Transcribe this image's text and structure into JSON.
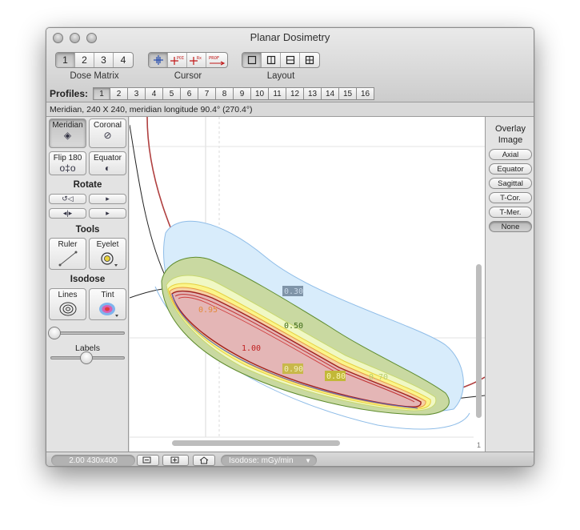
{
  "window": {
    "title": "Planar Dosimetry"
  },
  "toolbar": {
    "dose_matrix": {
      "label": "Dose Matrix",
      "options": [
        "1",
        "2",
        "3",
        "4"
      ],
      "selected": "1"
    },
    "cursor": {
      "label": "Cursor",
      "tools": [
        {
          "name": "crosshair",
          "text": ""
        },
        {
          "name": "poi",
          "text": "POI"
        },
        {
          "name": "rx",
          "text": "Rx"
        },
        {
          "name": "prof",
          "text": "PROF"
        }
      ]
    },
    "layout": {
      "label": "Layout"
    }
  },
  "profiles": {
    "label": "Profiles:",
    "items": [
      "1",
      "2",
      "3",
      "4",
      "5",
      "6",
      "7",
      "8",
      "9",
      "10",
      "11",
      "12",
      "13",
      "14",
      "15",
      "16"
    ],
    "selected": "1"
  },
  "info_line": "Meridian, 240 X 240, meridian longitude 90.4° (270.4°)",
  "left_panel": {
    "view_buttons": {
      "meridian": "Meridian",
      "coronal": "Coronal",
      "flip": "Flip 180",
      "equator": "Equator"
    },
    "rotate": {
      "label": "Rotate"
    },
    "tools": {
      "label": "Tools",
      "ruler": "Ruler",
      "eyelet": "Eyelet"
    },
    "isodose": {
      "label": "Isodose",
      "lines": "Lines",
      "tint": "Tint"
    },
    "labels_slider": {
      "label": "Labels"
    }
  },
  "overlay": {
    "title_line1": "Overlay",
    "title_line2": "Image",
    "options": [
      "Axial",
      "Equator",
      "Sagittal",
      "T-Cor.",
      "T-Mer.",
      "None"
    ],
    "selected": "None"
  },
  "canvas": {
    "isodose_labels": {
      "l100": "1.00",
      "l095": "0.95",
      "l090": "0.90",
      "l080": "0.80",
      "l070": "0.70",
      "l050": "0.50",
      "l030": "0.30"
    },
    "scroll_page": "1"
  },
  "status_bar": {
    "zoom_info": "2.00 430x400",
    "isodose_unit": "Isodose: mGy/min"
  },
  "colors": {
    "band_blue": "#d8ecfb",
    "band_green": "#c9d9a1",
    "band_dark_red": "#a02020",
    "overlay_red": "#b04040"
  }
}
